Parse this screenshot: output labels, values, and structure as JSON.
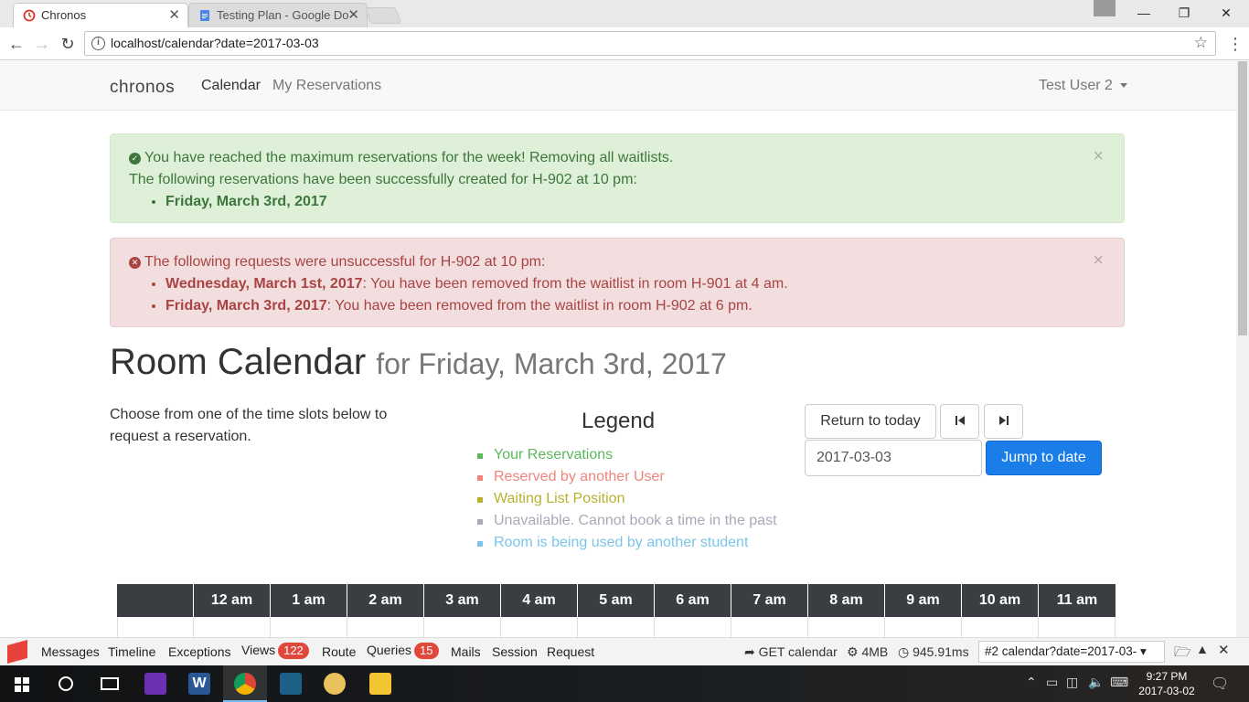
{
  "browser": {
    "tabs": [
      {
        "title": "Chronos",
        "active": true
      },
      {
        "title": "Testing Plan - Google Do",
        "active": false
      }
    ],
    "url": "localhost/calendar?date=2017-03-03"
  },
  "navbar": {
    "brand": "chronos",
    "links": [
      "Calendar",
      "My Reservations"
    ],
    "user": "Test User 2"
  },
  "alerts": {
    "success": {
      "line1": "You have reached the maximum reservations for the week! Removing all waitlists.",
      "line2": "The following reservations have been successfully created for H-902 at 10 pm:",
      "items": [
        "Friday, March 3rd, 2017"
      ]
    },
    "danger": {
      "line1": "The following requests were unsuccessful for H-902 at 10 pm:",
      "items": [
        {
          "date": "Wednesday, March 1st, 2017",
          "msg": ": You have been removed from the waitlist in room H-901 at 4 am."
        },
        {
          "date": "Friday, March 3rd, 2017",
          "msg": ": You have been removed from the waitlist in room H-902 at 6 pm."
        }
      ]
    },
    "close": "×"
  },
  "page": {
    "title": "Room Calendar",
    "subtitle": "for Friday, March 3rd, 2017",
    "intro": "Choose from one of the time slots below to request a reservation."
  },
  "legend": {
    "title": "Legend",
    "items": [
      {
        "label": "Your Reservations",
        "color": "#5cb85c"
      },
      {
        "label": "Reserved by another User",
        "color": "#f0837c"
      },
      {
        "label": "Waiting List Position",
        "color": "#b7b22e"
      },
      {
        "label": "Unavailable. Cannot book a time in the past",
        "color": "#a9a9b8"
      },
      {
        "label": "Room is being used by another student",
        "color": "#7cc4e8"
      }
    ]
  },
  "controls": {
    "return_today": "Return to today",
    "date_value": "2017-03-03",
    "jump": "Jump to date"
  },
  "calendar": {
    "hours": [
      "12 am",
      "1 am",
      "2 am",
      "3 am",
      "4 am",
      "5 am",
      "6 am",
      "7 am",
      "8 am",
      "9 am",
      "10 am",
      "11 am"
    ]
  },
  "debugbar": {
    "tabs": [
      "Messages",
      "Timeline",
      "Exceptions",
      "Views",
      "Route",
      "Queries",
      "Mails",
      "Session",
      "Request"
    ],
    "views_count": "122",
    "queries_count": "15",
    "route": "GET calendar",
    "memory": "4MB",
    "time": "945.91ms",
    "request": "#2 calendar?date=2017-03-"
  },
  "taskbar": {
    "time": "9:27 PM",
    "date": "2017-03-02"
  }
}
